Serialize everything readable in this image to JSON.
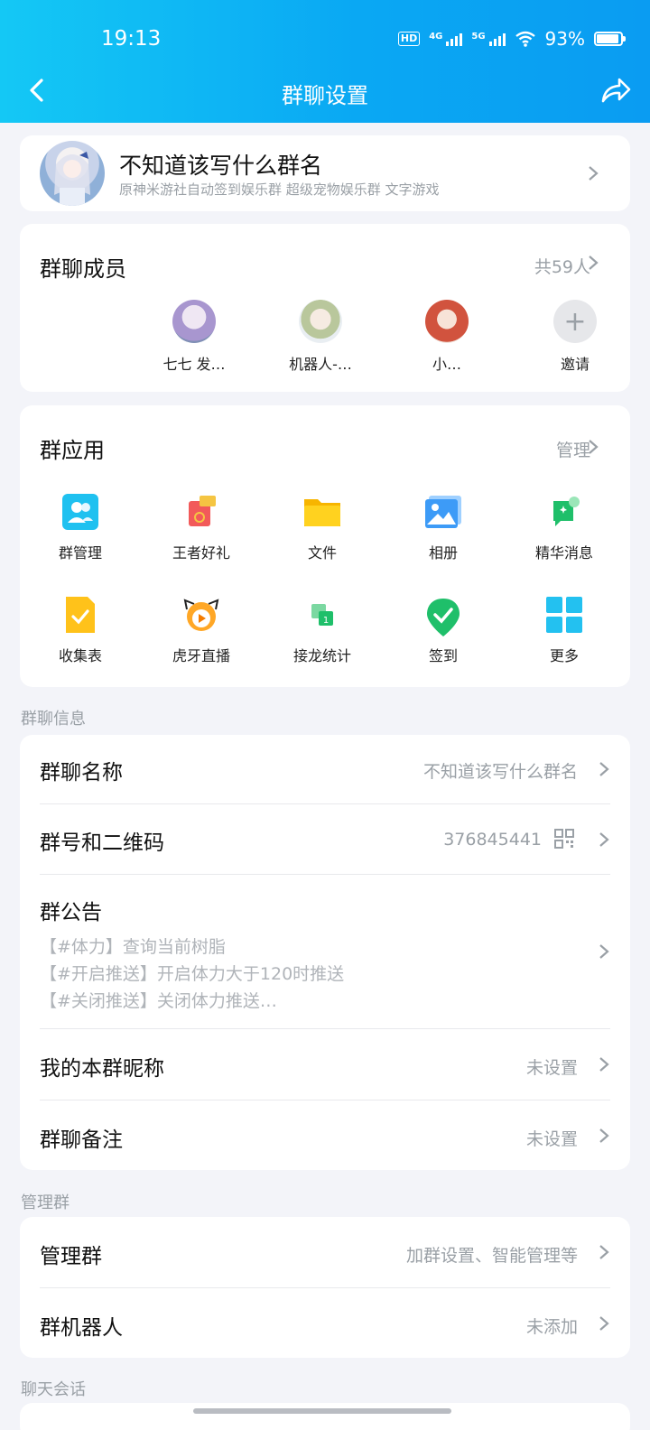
{
  "status_bar": {
    "time": "19:13",
    "hd": "HD",
    "net1": "4G",
    "net2": "5G",
    "battery": "93%"
  },
  "nav": {
    "title": "群聊设置"
  },
  "group": {
    "name": "不知道该写什么群名",
    "tags": "原神米游社自动签到娱乐群 超级宠物娱乐群  文字游戏"
  },
  "members": {
    "title": "群聊成员",
    "count": "共59人",
    "list": [
      {
        "name": "七七  发…",
        "color": "#b9a7d6"
      },
      {
        "name": "机器人-…",
        "color": "#cdd8b8"
      },
      {
        "name": "小…",
        "color": "#d86a5a"
      }
    ],
    "invite_label": "邀请"
  },
  "apps": {
    "title": "群应用",
    "manage_label": "管理",
    "items": [
      {
        "label": "群管理",
        "icon": "group-manage-icon"
      },
      {
        "label": "王者好礼",
        "icon": "gift-icon"
      },
      {
        "label": "文件",
        "icon": "folder-icon"
      },
      {
        "label": "相册",
        "icon": "photo-album-icon"
      },
      {
        "label": "精华消息",
        "icon": "featured-message-icon"
      },
      {
        "label": "收集表",
        "icon": "form-icon"
      },
      {
        "label": "虎牙直播",
        "icon": "huya-live-icon"
      },
      {
        "label": "接龙统计",
        "icon": "relay-stat-icon"
      },
      {
        "label": "签到",
        "icon": "checkin-icon"
      },
      {
        "label": "更多",
        "icon": "more-grid-icon"
      }
    ]
  },
  "info_section": {
    "label": "群聊信息",
    "group_name": {
      "title": "群聊名称",
      "value": "不知道该写什么群名"
    },
    "group_number": {
      "title": "群号和二维码",
      "value": "376845441"
    },
    "notice": {
      "title": "群公告",
      "lines": [
        "【#体力】查询当前树脂",
        "【#开启推送】开启体力大于120时推送",
        "【#关闭推送】关闭体力推送…"
      ]
    },
    "nickname": {
      "title": "我的本群昵称",
      "value": "未设置"
    },
    "remark": {
      "title": "群聊备注",
      "value": "未设置"
    }
  },
  "manage_section": {
    "label": "管理群",
    "manage": {
      "title": "管理群",
      "value": "加群设置、智能管理等"
    },
    "robot": {
      "title": "群机器人",
      "value": "未添加"
    }
  },
  "chat_section": {
    "label": "聊天会话"
  }
}
